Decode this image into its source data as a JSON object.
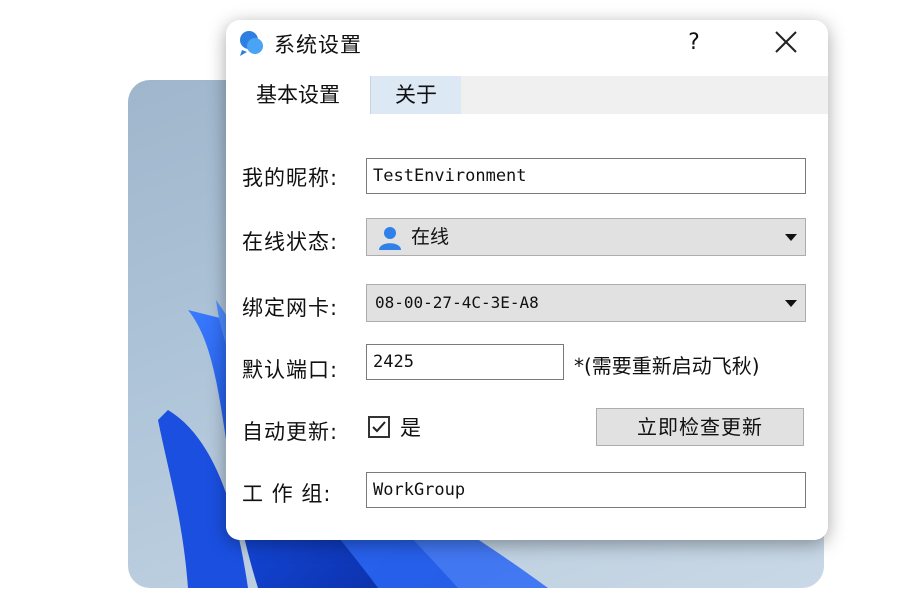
{
  "dialog": {
    "title": "系统设置",
    "help_label": "?",
    "icons": {
      "app": "chat-bubbles-icon",
      "close": "close-icon"
    }
  },
  "tabs": [
    {
      "label": "基本设置",
      "active": true
    },
    {
      "label": "关于",
      "active": false
    }
  ],
  "form": {
    "nickname": {
      "label": "我的昵称:",
      "value": "TestEnvironment"
    },
    "status": {
      "label": "在线状态:",
      "value": "在线",
      "icon": "user-icon"
    },
    "nic": {
      "label": "绑定网卡:",
      "value": "08-00-27-4C-3E-A8"
    },
    "port": {
      "label": "默认端口:",
      "value": "2425",
      "note": "*(需要重新启动飞秋)"
    },
    "auto_update": {
      "label": "自动更新:",
      "checked": true,
      "option_label": "是",
      "button_label": "立即检查更新"
    },
    "workgroup": {
      "label": "工 作 组:",
      "value": "WorkGroup"
    }
  }
}
